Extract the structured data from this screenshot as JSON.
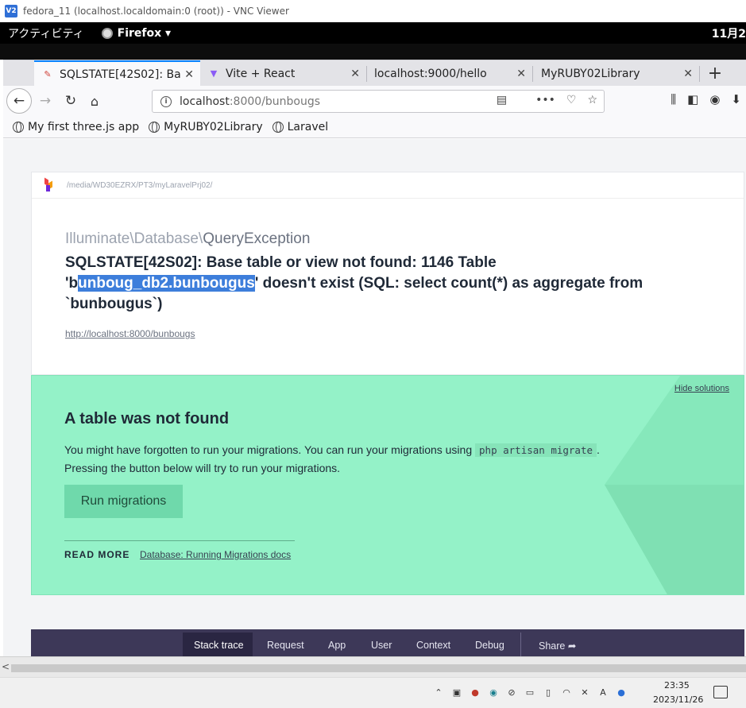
{
  "vnc": {
    "title": "fedora_11 (localhost.localdomain:0 (root)) - VNC Viewer",
    "logo": "V2"
  },
  "gnome": {
    "activities": "アクティビティ",
    "app": "Firefox ▾",
    "clock": "11月2"
  },
  "tabs": [
    {
      "label": "SQLSTATE[42S02]: Ba",
      "icon": "pen-icon",
      "active": true
    },
    {
      "label": "Vite + React",
      "icon": "vite-icon",
      "active": false
    },
    {
      "label": "localhost:9000/hello",
      "icon": "",
      "active": false
    },
    {
      "label": "MyRUBY02Library",
      "icon": "",
      "active": false
    }
  ],
  "urlbar": {
    "host": "localhost",
    "rest": ":8000/bunbougs"
  },
  "bookmarks": [
    "My first three.js app",
    "MyRUBY02Library",
    "Laravel"
  ],
  "error": {
    "path": "/media/WD30EZRX/PT3/myLaravelPrj02/",
    "class_prefix": "Illuminate\\Database\\",
    "class_name": "QueryException",
    "msg_part1": "SQLSTATE[42S02]: Base table or view not found: 1146 Table 'b",
    "msg_selected": "unboug_db2.bunbougus",
    "msg_part2": "' doesn't exist (SQL: select count(*) as aggregate from `bunbougus`)",
    "url": "http://localhost:8000/bunbougs"
  },
  "solution": {
    "hide_label": "Hide solutions",
    "title": "A table was not found",
    "text1": "You might have forgotten to run your migrations. You can run your migrations using ",
    "code": "php artisan migrate",
    "text2": ".",
    "text3": "Pressing the button below will try to run your migrations.",
    "button": "Run migrations",
    "read_more": "READ MORE",
    "link": "Database: Running Migrations docs"
  },
  "bottom_tabs": [
    "Stack trace",
    "Request",
    "App",
    "User",
    "Context",
    "Debug",
    "Share"
  ],
  "taskbar": {
    "time": "23:35",
    "date": "2023/11/26"
  }
}
